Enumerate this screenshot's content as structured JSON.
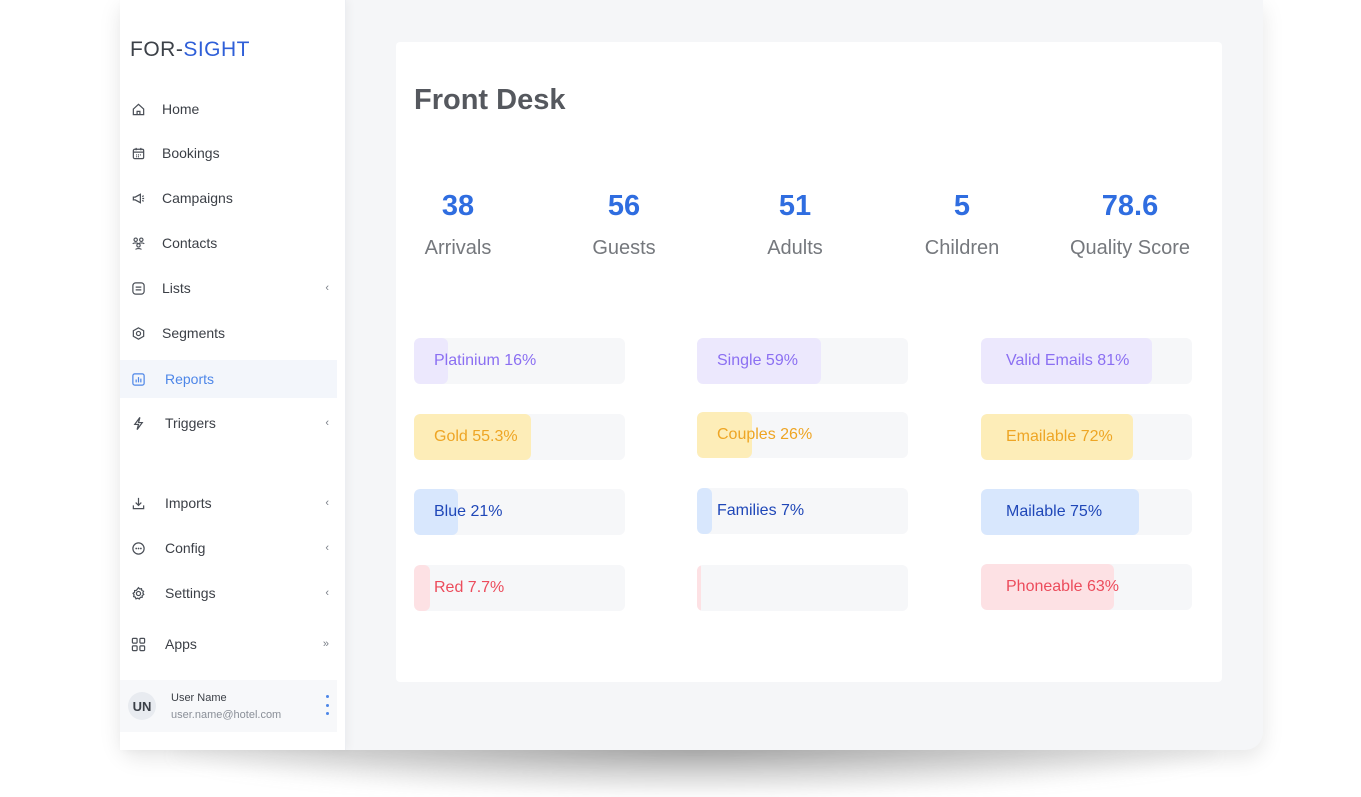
{
  "brand": {
    "part1": "FOR-",
    "part2": "SIGHT"
  },
  "sidebar": {
    "items": [
      {
        "label": "Home",
        "icon": "home-icon",
        "chevron": ""
      },
      {
        "label": "Bookings",
        "icon": "calendar-icon",
        "chevron": ""
      },
      {
        "label": "Campaigns",
        "icon": "megaphone-icon",
        "chevron": ""
      },
      {
        "label": "Contacts",
        "icon": "contacts-icon",
        "chevron": ""
      },
      {
        "label": "Lists",
        "icon": "list-icon",
        "chevron": "‹"
      },
      {
        "label": "Segments",
        "icon": "segments-icon",
        "chevron": ""
      },
      {
        "label": "Reports",
        "icon": "reports-icon",
        "chevron": "",
        "active": true
      },
      {
        "label": "Triggers",
        "icon": "lightning-icon",
        "chevron": "‹"
      },
      {
        "label": "Imports",
        "icon": "import-icon",
        "chevron": "‹"
      },
      {
        "label": "Config",
        "icon": "config-icon",
        "chevron": "‹"
      },
      {
        "label": "Settings",
        "icon": "gear-icon",
        "chevron": "‹"
      },
      {
        "label": "Apps",
        "icon": "apps-grid-icon",
        "chevron": "»"
      }
    ],
    "user": {
      "initials": "UN",
      "name": "User Name",
      "email": "user.name@hotel.com"
    }
  },
  "main": {
    "title": "Front Desk",
    "stats": [
      {
        "value": "38",
        "label": "Arrivals"
      },
      {
        "value": "56",
        "label": "Guests"
      },
      {
        "value": "51",
        "label": "Adults"
      },
      {
        "value": "5",
        "label": "Children"
      },
      {
        "value": "78.6",
        "label": "Quality Score"
      }
    ],
    "columns": [
      [
        {
          "label": "Platinium 16%",
          "percent": 16,
          "color": "purple"
        },
        {
          "label": "Gold 55.3%",
          "percent": 55.3,
          "color": "yellow"
        },
        {
          "label": "Blue 21%",
          "percent": 21,
          "color": "blue"
        },
        {
          "label": "Red 7.7%",
          "percent": 7.7,
          "color": "red"
        }
      ],
      [
        {
          "label": "Single 59%",
          "percent": 59,
          "color": "purple"
        },
        {
          "label": "Couples 26%",
          "percent": 26,
          "color": "yellow"
        },
        {
          "label": "Families 7%",
          "percent": 7,
          "color": "blue"
        },
        {
          "label": "",
          "percent": 2,
          "color": "red"
        }
      ],
      [
        {
          "label": "Valid Emails 81%",
          "percent": 81,
          "color": "purple"
        },
        {
          "label": "Emailable 72%",
          "percent": 72,
          "color": "yellow"
        },
        {
          "label": "Mailable 75%",
          "percent": 75,
          "color": "blue"
        },
        {
          "label": "Phoneable 63%",
          "percent": 63,
          "color": "red"
        }
      ]
    ]
  },
  "colors": {
    "accent": "#2f6de0",
    "purple": "#8b6ff2",
    "yellow": "#eea524",
    "blue": "#1f47b8",
    "red": "#ec4c5c"
  }
}
